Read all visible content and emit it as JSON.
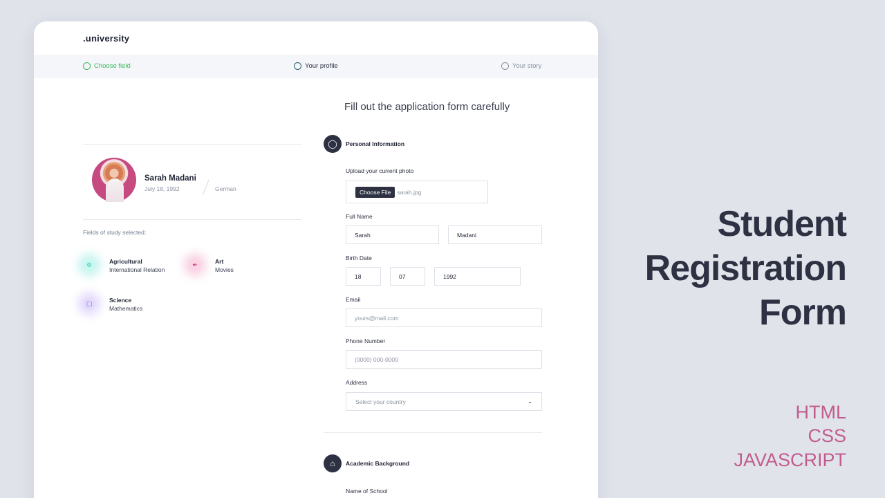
{
  "brand": ".university",
  "steps": [
    {
      "label": "Choose field",
      "state": "completed"
    },
    {
      "label": "Your profile",
      "state": "active"
    },
    {
      "label": "Your story",
      "state": "upcoming"
    }
  ],
  "form_title": "Fill out the application form carefully",
  "profile": {
    "name": "Sarah Madani",
    "dob": "July 18, 1992",
    "nationality": "German",
    "fields_label": "Fields of study selected:",
    "fields": [
      {
        "title": "Agricultural",
        "subtitle": "International Relation",
        "icon": "tractor-icon",
        "color": "#34c6b7"
      },
      {
        "title": "Art",
        "subtitle": "Movies",
        "icon": "feather-icon",
        "color": "#d1397a"
      },
      {
        "title": "Science",
        "subtitle": "Mathematics",
        "icon": "book-icon",
        "color": "#7a59e6"
      }
    ]
  },
  "personal": {
    "section_title": "Personal Information",
    "photo_label": "Upload your current photo",
    "file_button": "Choose File",
    "file_name": "sarah.jpg",
    "full_name_label": "Full Name",
    "first_name": "Sarah",
    "last_name": "Madani",
    "birth_label": "Birth Date",
    "day": "18",
    "month": "07",
    "year": "1992",
    "email_label": "Email",
    "email_placeholder": "yours@mail.com",
    "phone_label": "Phone Number",
    "phone_placeholder": "(0000) 000-0000",
    "address_label": "Address",
    "country_placeholder": "Select your country"
  },
  "academic": {
    "section_title": "Academic Background",
    "school_label": "Name of School"
  },
  "promo": {
    "line1": "Student",
    "line2": "Registration",
    "line3": "Form",
    "tech": [
      "HTML",
      "CSS",
      "JAVASCRIPT"
    ]
  },
  "colors": {
    "background": "#e0e3ea",
    "dark": "#2d3142",
    "step_done": "#3dbb5e",
    "tech_accent": "#c35c8e"
  }
}
